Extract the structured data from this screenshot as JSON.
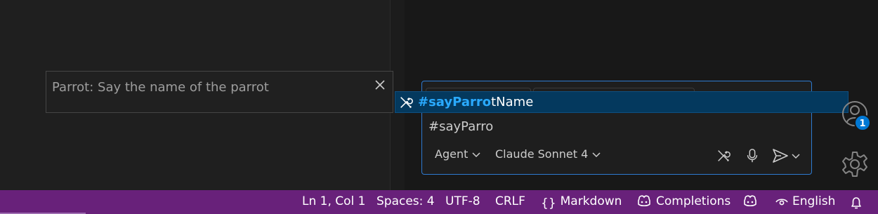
{
  "hover": {
    "text": "Parrot: Say the name of the parrot",
    "close_icon": "close-icon"
  },
  "suggest": {
    "match": "#sayParro",
    "rest": "tName",
    "icon": "tools-icon"
  },
  "chat": {
    "input_value": "#sayParro",
    "mode_label": "Agent",
    "model_label": "Claude Sonnet 4",
    "icons": [
      "tools-icon",
      "microphone-icon",
      "send-icon",
      "chevron-down-icon"
    ],
    "accent_color": "#2e7bd1"
  },
  "activity": {
    "account_badge": "1",
    "icons": [
      "account-icon",
      "gear-icon"
    ]
  },
  "status": {
    "position": "Ln 1, Col 1",
    "spaces": "Spaces: 4",
    "encoding": "UTF-8",
    "eol": "CRLF",
    "language_glyph": "{}",
    "language": "Markdown",
    "completions": "Completions",
    "locale": "English",
    "background_color": "#68217a"
  }
}
